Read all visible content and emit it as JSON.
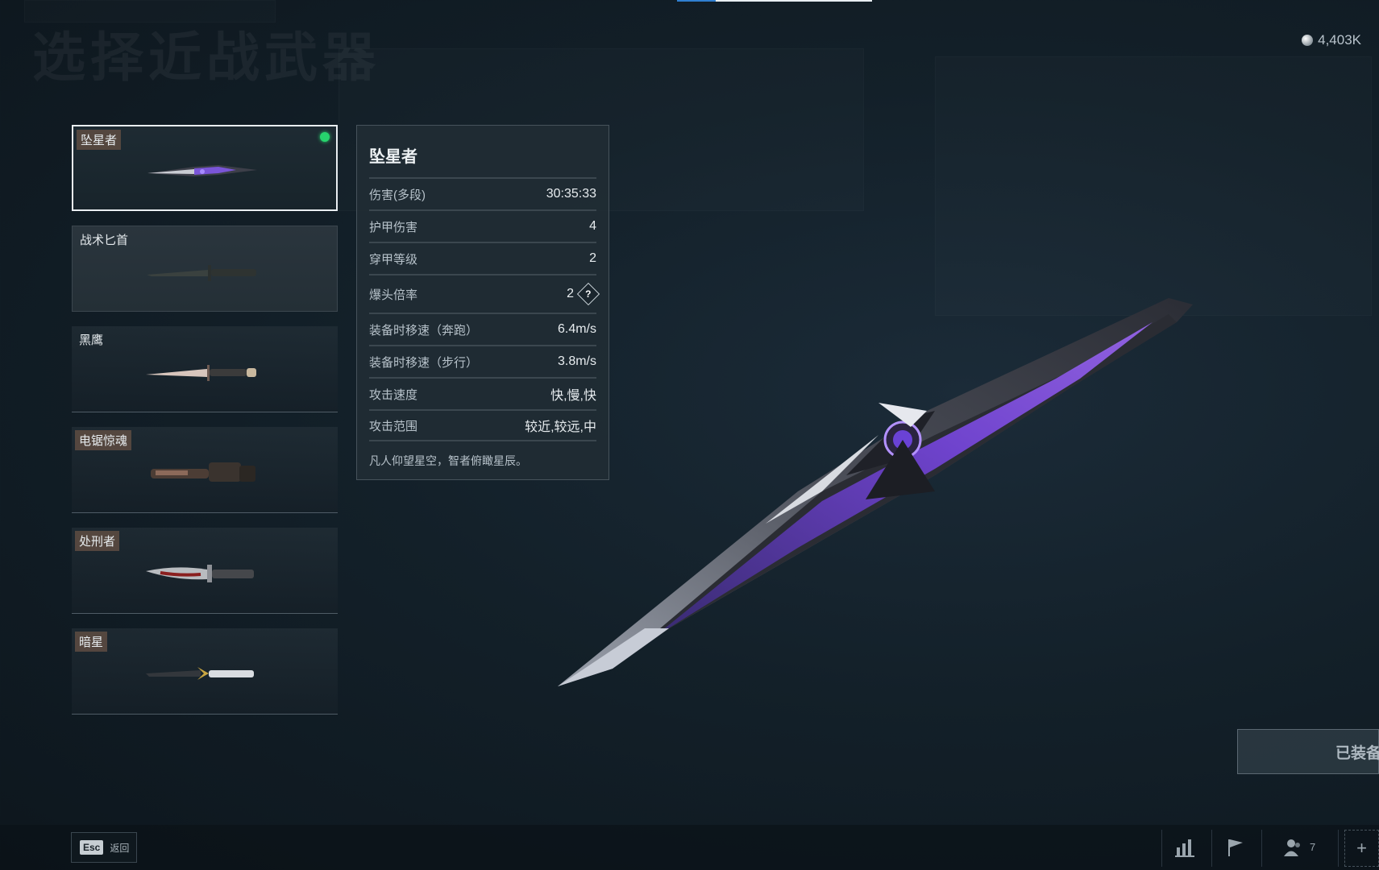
{
  "header": {
    "ghost_title": "选择近战武器",
    "currency_value": "4,403K"
  },
  "weapons": [
    {
      "name": "坠星者",
      "selected": true,
      "equipped": true
    },
    {
      "name": "战术匕首",
      "selected": false,
      "equipped": false
    },
    {
      "name": "黑鹰",
      "selected": false,
      "equipped": false
    },
    {
      "name": "电锯惊魂",
      "selected": false,
      "equipped": false
    },
    {
      "name": "处刑者",
      "selected": false,
      "equipped": false
    },
    {
      "name": "暗星",
      "selected": false,
      "equipped": false
    }
  ],
  "stats": {
    "title": "坠星者",
    "rows": [
      {
        "label": "伤害(多段)",
        "value": "30:35:33"
      },
      {
        "label": "护甲伤害",
        "value": "4"
      },
      {
        "label": "穿甲等级",
        "value": "2"
      },
      {
        "label": "爆头倍率",
        "value": "2"
      },
      {
        "label": "装备时移速（奔跑）",
        "value": "6.4m/s"
      },
      {
        "label": "装备时移速（步行）",
        "value": "3.8m/s"
      },
      {
        "label": "攻击速度",
        "value": "快,慢,快"
      },
      {
        "label": "攻击范围",
        "value": "较近,较远,中"
      }
    ],
    "help_glyph": "?",
    "description": "凡人仰望星空，智者俯瞰星辰。"
  },
  "equip_button": {
    "label": "已装备"
  },
  "bottom_bar": {
    "esc_key": "Esc",
    "esc_label": "返回",
    "party_count": "7",
    "plus_glyph": "+"
  },
  "colors": {
    "equipped_indicator": "#27d46d",
    "accent_purple": "#8a4dff",
    "tab_accent": "#2f7fd0"
  },
  "icons": [
    "coin-icon",
    "stats-icon",
    "flag-icon",
    "party-icon",
    "plus-icon",
    "help-icon"
  ]
}
